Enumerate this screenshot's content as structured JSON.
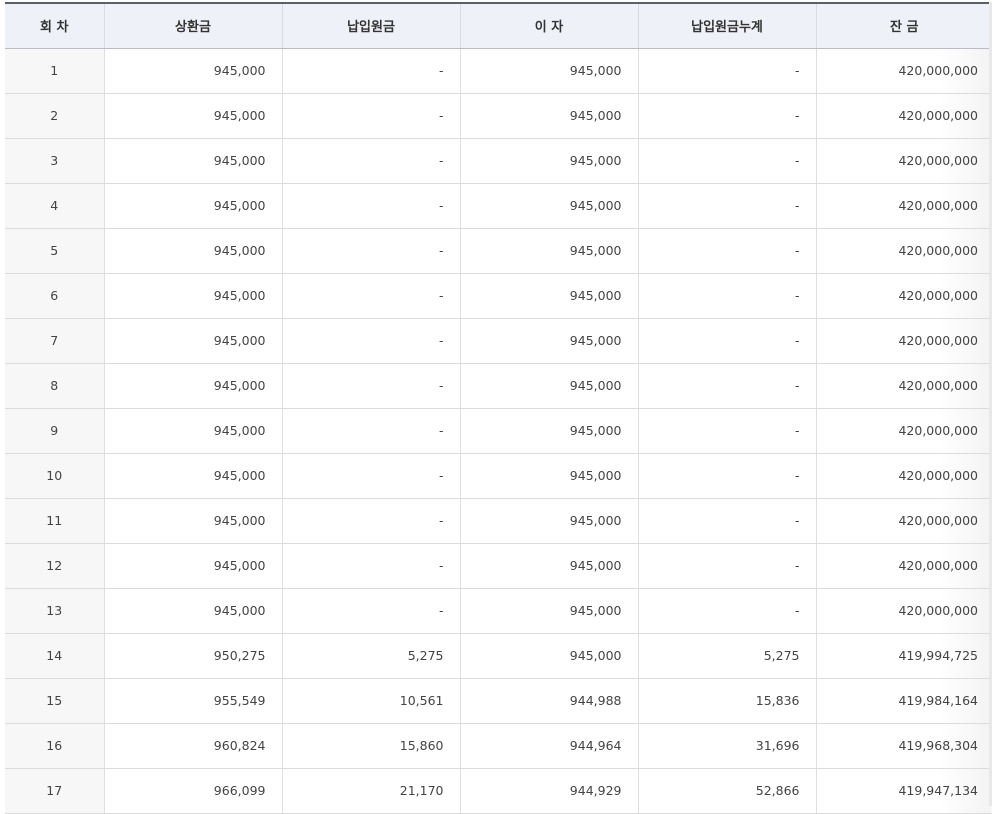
{
  "table": {
    "headers": [
      "회 차",
      "상환금",
      "납입원금",
      "이 자",
      "납입원금누계",
      "잔 금"
    ],
    "rows": [
      [
        "1",
        "945,000",
        "-",
        "945,000",
        "-",
        "420,000,000"
      ],
      [
        "2",
        "945,000",
        "-",
        "945,000",
        "-",
        "420,000,000"
      ],
      [
        "3",
        "945,000",
        "-",
        "945,000",
        "-",
        "420,000,000"
      ],
      [
        "4",
        "945,000",
        "-",
        "945,000",
        "-",
        "420,000,000"
      ],
      [
        "5",
        "945,000",
        "-",
        "945,000",
        "-",
        "420,000,000"
      ],
      [
        "6",
        "945,000",
        "-",
        "945,000",
        "-",
        "420,000,000"
      ],
      [
        "7",
        "945,000",
        "-",
        "945,000",
        "-",
        "420,000,000"
      ],
      [
        "8",
        "945,000",
        "-",
        "945,000",
        "-",
        "420,000,000"
      ],
      [
        "9",
        "945,000",
        "-",
        "945,000",
        "-",
        "420,000,000"
      ],
      [
        "10",
        "945,000",
        "-",
        "945,000",
        "-",
        "420,000,000"
      ],
      [
        "11",
        "945,000",
        "-",
        "945,000",
        "-",
        "420,000,000"
      ],
      [
        "12",
        "945,000",
        "-",
        "945,000",
        "-",
        "420,000,000"
      ],
      [
        "13",
        "945,000",
        "-",
        "945,000",
        "-",
        "420,000,000"
      ],
      [
        "14",
        "950,275",
        "5,275",
        "945,000",
        "5,275",
        "419,994,725"
      ],
      [
        "15",
        "955,549",
        "10,561",
        "944,988",
        "15,836",
        "419,984,164"
      ],
      [
        "16",
        "960,824",
        "15,860",
        "944,964",
        "31,696",
        "419,968,304"
      ],
      [
        "17",
        "966,099",
        "21,170",
        "944,929",
        "52,866",
        "419,947,134"
      ]
    ]
  }
}
